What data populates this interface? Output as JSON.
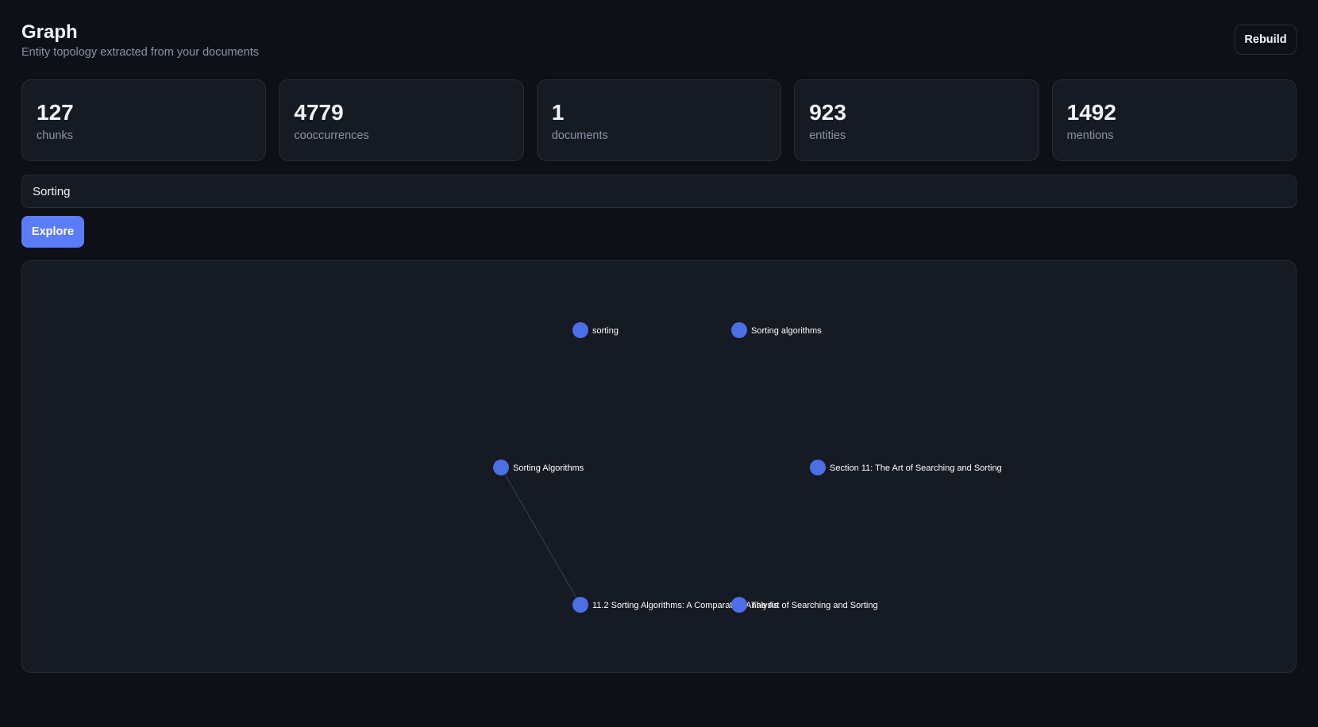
{
  "header": {
    "title": "Graph",
    "subtitle": "Entity topology extracted from your documents",
    "rebuild_label": "Rebuild"
  },
  "stats": [
    {
      "value": "127",
      "label": "chunks"
    },
    {
      "value": "4779",
      "label": "cooccurrences"
    },
    {
      "value": "1",
      "label": "documents"
    },
    {
      "value": "923",
      "label": "entities"
    },
    {
      "value": "1492",
      "label": "mentions"
    }
  ],
  "search": {
    "value": "Sorting",
    "explore_label": "Explore"
  },
  "graph": {
    "node_color": "#4c6ee6",
    "edge_color": "#3a4050",
    "nodes": [
      {
        "id": "n1",
        "label": "sorting"
      },
      {
        "id": "n2",
        "label": "Sorting algorithms"
      },
      {
        "id": "n3",
        "label": "Sorting Algorithms"
      },
      {
        "id": "n4",
        "label": "Section 11: The Art of Searching and Sorting"
      },
      {
        "id": "n5",
        "label": "11.2 Sorting Algorithms: A Comparative Analysis"
      },
      {
        "id": "n6",
        "label": "The Art of Searching and Sorting"
      }
    ],
    "edges": [
      {
        "from": "n3",
        "to": "n5"
      }
    ]
  }
}
